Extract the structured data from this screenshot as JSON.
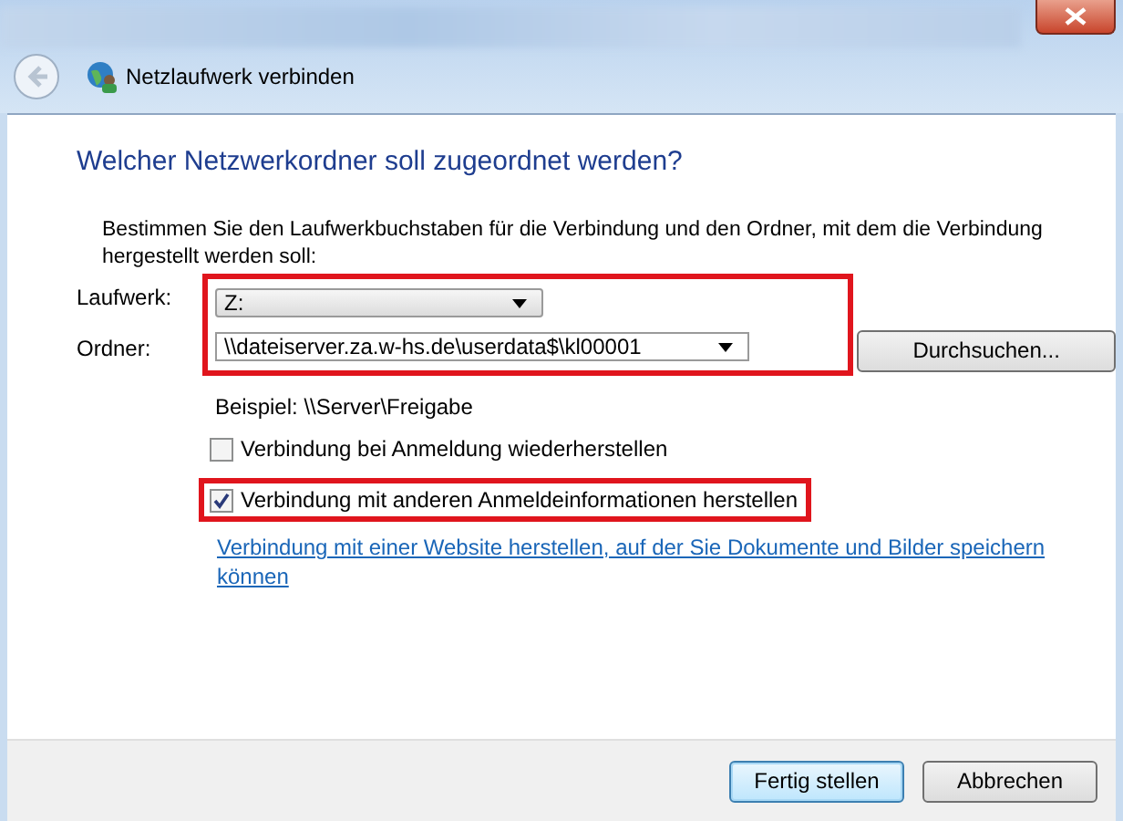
{
  "window": {
    "title": "Netzlaufwerk verbinden"
  },
  "heading": "Welcher Netzwerkordner soll zugeordnet werden?",
  "instruction": "Bestimmen Sie den Laufwerkbuchstaben für die Verbindung und den Ordner, mit dem die Verbindung hergestellt werden soll:",
  "fields": {
    "highlighted": true,
    "drive": {
      "label": "Laufwerk:",
      "value": "Z:"
    },
    "folder": {
      "label": "Ordner:",
      "value": "\\\\dateiserver.za.w-hs.de\\userdata$\\kl00001"
    },
    "browse": "Durchsuchen..."
  },
  "example": "Beispiel: \\\\Server\\Freigabe",
  "checkboxes": [
    {
      "label": "Verbindung bei Anmeldung wiederherstellen",
      "checked": false,
      "highlighted": false
    },
    {
      "label": "Verbindung mit anderen Anmeldeinformationen herstellen",
      "checked": true,
      "highlighted": true
    }
  ],
  "link": "Verbindung mit einer Website herstellen, auf der Sie Dokumente und Bilder speichern können",
  "buttons": [
    {
      "label": "Fertig stellen",
      "default": true
    },
    {
      "label": "Abbrechen",
      "default": false
    }
  ]
}
